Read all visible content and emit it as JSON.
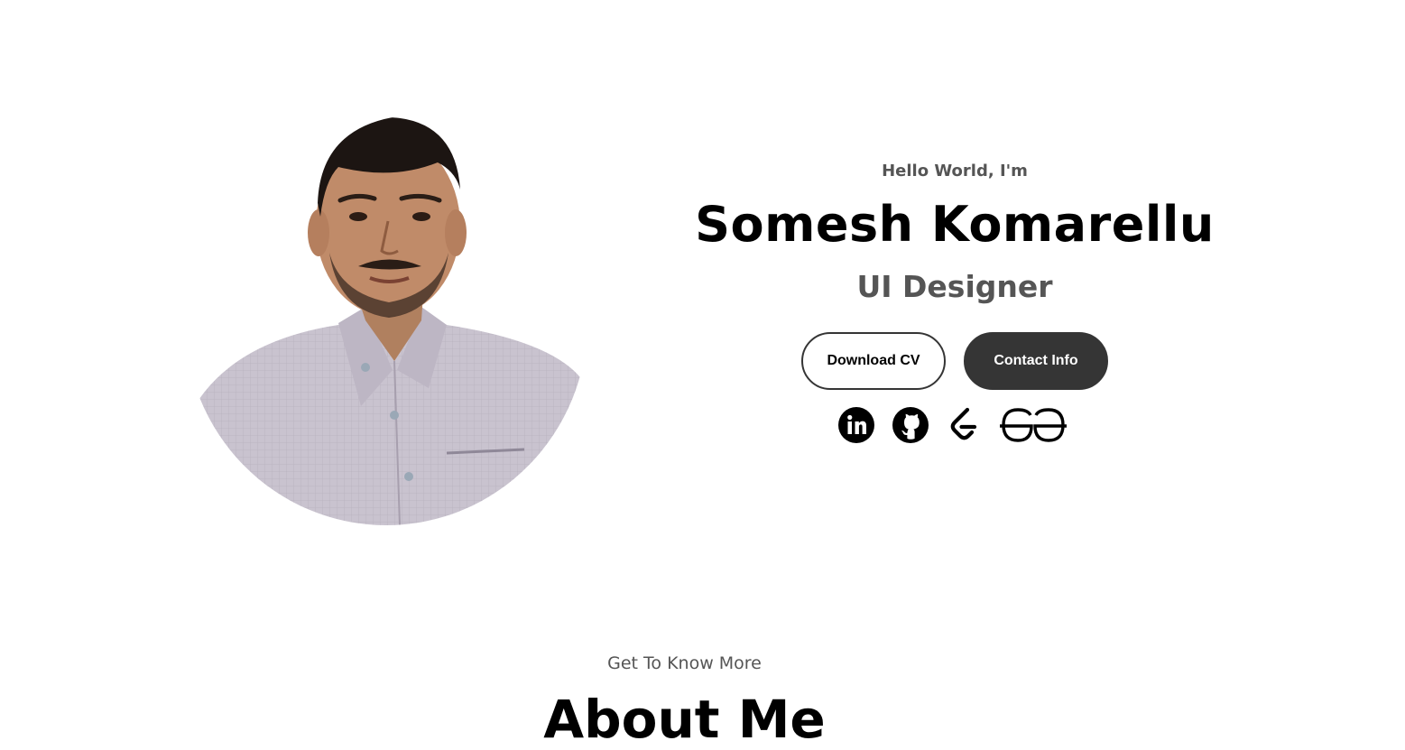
{
  "hero": {
    "greeting": "Hello World, I'm",
    "name": "Somesh Komarellu",
    "role": "UI Designer",
    "buttons": {
      "download_cv": "Download CV",
      "contact_info": "Contact Info"
    },
    "socials": [
      {
        "icon": "linkedin-icon"
      },
      {
        "icon": "github-icon"
      },
      {
        "icon": "leetcode-icon"
      },
      {
        "icon": "geeksforgeeks-icon"
      }
    ]
  },
  "about": {
    "subtitle": "Get To Know More",
    "title": "About Me"
  },
  "colors": {
    "text_dark": "#000000",
    "text_muted": "#555555",
    "button_dark": "#353535",
    "background": "#ffffff"
  }
}
